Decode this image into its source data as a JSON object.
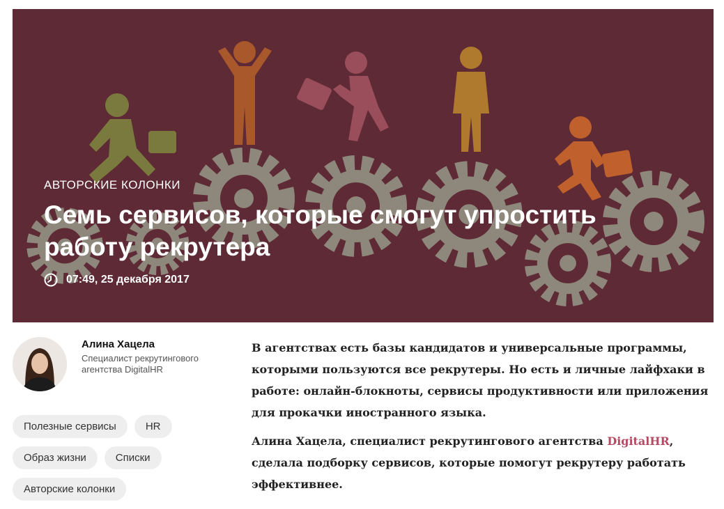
{
  "hero": {
    "rubric": "Авторские колонки",
    "title": "Семь сервисов, которые смогут упростить работу рекрутера",
    "date": "07:49, 25 декабря 2017",
    "background_color": "#5e2a35",
    "icon": "clock-icon"
  },
  "author": {
    "name": "Алина Хацела",
    "role": "Специалист рекрутингового агентства DigitalHR"
  },
  "tags": [
    "Полезные сервисы",
    "HR",
    "Образ жизни",
    "Списки",
    "Авторские колонки"
  ],
  "article": {
    "paragraph1": "В агентствах есть базы кандидатов и универсальные программы, которыми пользуются все рекрутеры. Но есть и личные лайфхаки в работе: онлайн-блокноты, сервисы продуктивности или приложения для прокачки иностранного языка.",
    "paragraph2_before": "Алина Хацела, специалист рекрутингового агентства ",
    "paragraph2_link": "DigitalHR",
    "paragraph2_after": ", сделала подборку сервисов, которые помогут рекрутеру работать эффективнее."
  },
  "colors": {
    "link": "#b34c63",
    "tag_bg": "#eeeeee"
  }
}
